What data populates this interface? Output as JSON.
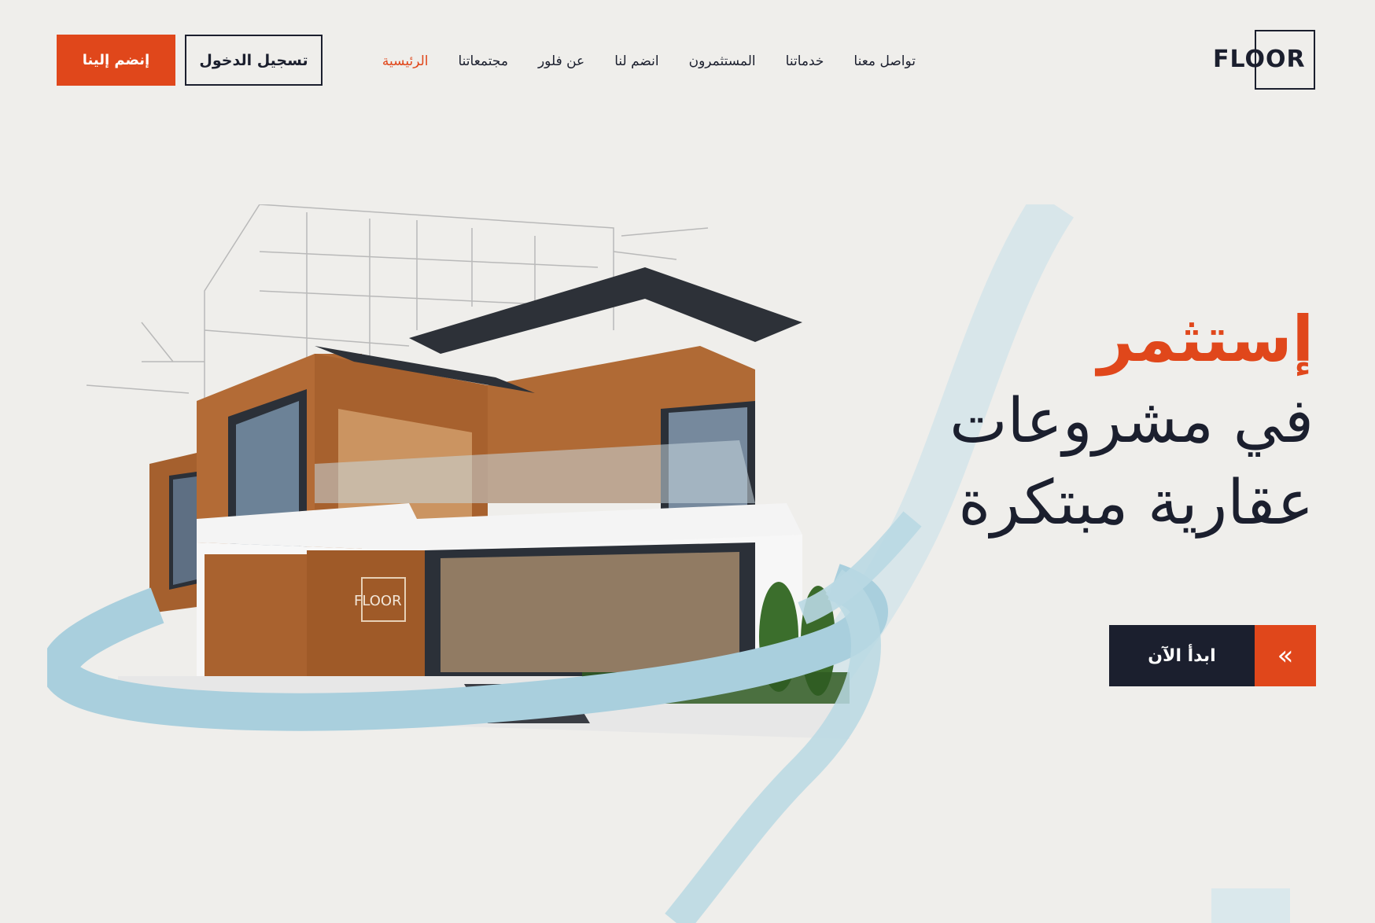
{
  "brand": {
    "logo_text": "FLOOR"
  },
  "nav": {
    "items": [
      {
        "label": "الرئيسية",
        "active": true
      },
      {
        "label": "مجتمعاتنا",
        "active": false
      },
      {
        "label": "عن فلور",
        "active": false
      },
      {
        "label": "انضم لنا",
        "active": false
      },
      {
        "label": "المستثمرون",
        "active": false
      },
      {
        "label": "خدماتنا",
        "active": false
      },
      {
        "label": "تواصل معنا",
        "active": false
      }
    ]
  },
  "header_actions": {
    "login_label": "تسجيل الدخول",
    "join_label": "إنضم إلينا"
  },
  "hero": {
    "accent_word": "إستثمر",
    "line_2": "في مشروعات",
    "line_3": "عقارية مبتكرة",
    "cta_label": "ابدأ الآن",
    "cta_icon": "double-chevron-left-icon",
    "building_sign": "FLOOR"
  },
  "colors": {
    "accent": "#e0471b",
    "dark": "#1b1f2e",
    "background": "#efeeeb",
    "swoosh": "#a9cfdd"
  }
}
